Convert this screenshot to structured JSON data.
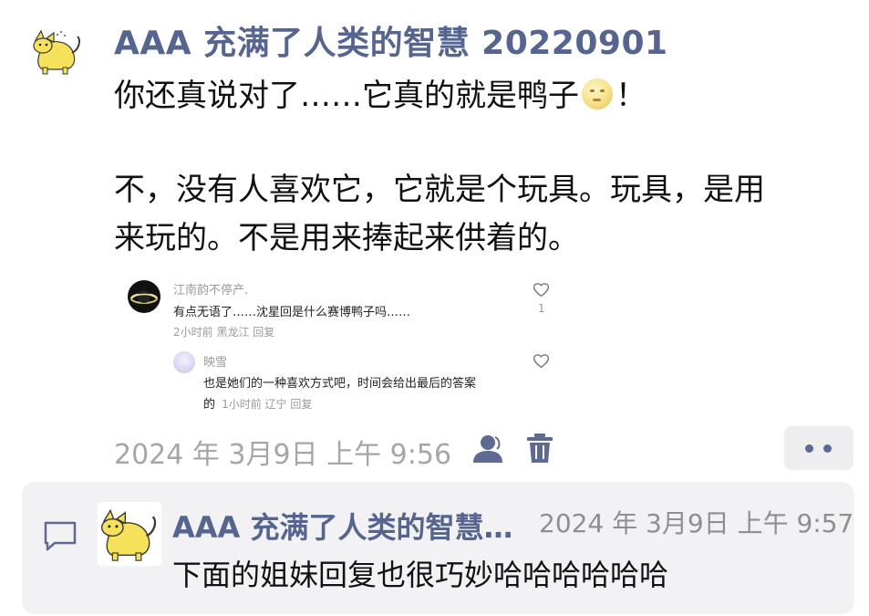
{
  "post": {
    "author": "AAA 充满了人类的智慧 20220901",
    "line1_a": "你还真说对了……它真的就是鸭子",
    "line1_b": "！",
    "line2": "不，没有人喜欢它，它就是个玩具。玩具，是用",
    "line3": "来玩的。不是用来捧起来供着的。",
    "timestamp": "2024 年 3月9日 上午 9:56"
  },
  "embedded": {
    "comment1": {
      "name": "江南韵不停产.",
      "text": "有点无语了……沈星回是什么赛博鸭子吗……",
      "meta": "2小时前 黑龙江 回复",
      "like_count": "1"
    },
    "reply1": {
      "name": "映雪",
      "text_line1": "也是她们的一种喜欢方式吧，时间会给出最后的答案",
      "text_line2_a": "的",
      "meta": "1小时前 辽宁 回复"
    }
  },
  "comment": {
    "author": "AAA 充满了人类的智慧…",
    "time": "2024 年 3月9日 上午 9:57",
    "text": "下面的姐妹回复也很巧妙哈哈哈哈哈哈"
  },
  "icons": {
    "avatar": "cat-avatar-icon",
    "emoji": "moon-face-emoji",
    "people": "people-icon",
    "trash": "trash-icon",
    "more": "more-dots-icon",
    "comment": "comment-icon",
    "heart": "heart-icon"
  },
  "colors": {
    "accent": "#56658f",
    "muted": "#a6a6a6",
    "comment_bg": "#f2f2f4"
  }
}
